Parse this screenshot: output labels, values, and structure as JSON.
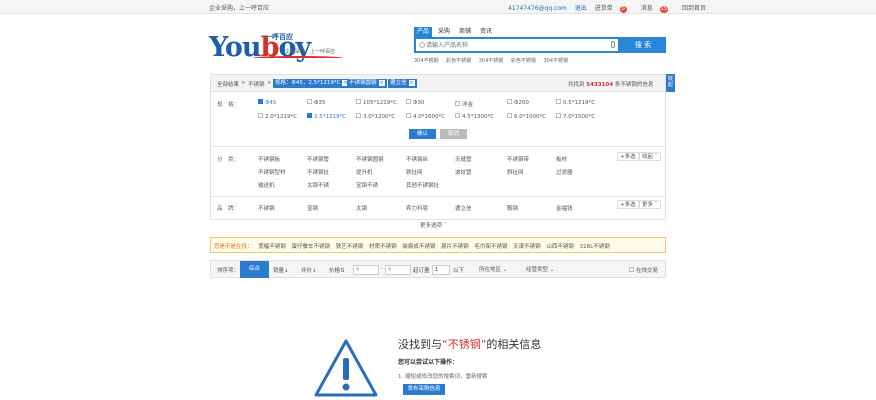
{
  "topbar": {
    "left": "企业采购，上一呼百应",
    "email": "41747476@qq.com",
    "exit": "退出",
    "purchase_label": "进货单",
    "purchase_count": "0",
    "messages_label": "消息",
    "messages_count": "15",
    "home": "回到首页"
  },
  "logo": {
    "word_a": "You",
    "word_b": "b",
    "word_c": "oy",
    "slogan_top": "一呼百应",
    "slogan": "企业采购，上一呼百应"
  },
  "search": {
    "tabs": [
      "产品",
      "采购",
      "商铺",
      "资讯"
    ],
    "placeholder": "请输入产品名称",
    "button": "搜 索",
    "hot": [
      "304不锈钢",
      "彩色不锈钢",
      "304不锈钢",
      "彩色不锈钢",
      "304不锈钢"
    ]
  },
  "crumb": {
    "all": "全部结果",
    "sep": ">",
    "keyword": "不锈钢",
    "tags": [
      "规格：Φ45，2.5*1219*C",
      "不锈钢圆钢",
      "德立信"
    ],
    "count_prefix": "共找到",
    "count": "5433104",
    "count_suffix": "条不锈钢的信息",
    "side_tab": "收起"
  },
  "filters": {
    "spec": {
      "label": "规　格：",
      "options": [
        [
          "Φ45",
          "Φ35",
          "105*1219*C",
          "Φ30",
          "洋金",
          "Φ200",
          "0.5*1219*C"
        ],
        [
          "2.0*1219*C",
          "2.5*1219*C",
          "3.0*1200*C",
          "4.0*1600*C",
          "4.5*1300*C",
          "6.0*1000*C",
          "7.0*1500*C"
        ]
      ],
      "ok": "确认",
      "cancel": "取消"
    },
    "category": {
      "label": "分　类：",
      "options": [
        [
          "不锈钢板",
          "不锈钢管",
          "不锈钢圆钢",
          "不锈钢丝",
          "无缝管",
          "不锈钢带",
          "板材"
        ],
        [
          "不锈钢型材",
          "不锈钢扯",
          "提升机",
          "铁扯网",
          "波纹管",
          "斜扯网",
          "过滤器"
        ],
        [
          "输送机",
          "太钢不锈",
          "宝钢不锈",
          "其他不锈钢扯"
        ]
      ],
      "multi": "+多选",
      "more": "收起"
    },
    "brand": {
      "label": "品　牌：",
      "options": [
        "不锈钢",
        "宝钢",
        "太钢",
        "宾力科恩",
        "德立信",
        "鞍钢",
        "金福钱"
      ],
      "multi": "+多选",
      "more": "更多"
    },
    "more_options": "更多选项"
  },
  "suggest": {
    "label": "您是不是在找：",
    "items": [
      "宽幅不锈钢",
      "蛋仔餐车不锈钢",
      "铁艺不锈钢",
      "材质不锈钢",
      "装扁成不锈钢",
      "扁片不锈钢",
      "毛巾架不锈钢",
      "天津不锈钢",
      "山西不锈钢",
      "316L不锈钢"
    ]
  },
  "sortbar": {
    "label": "排序项：",
    "default": "综合",
    "sales": "销量",
    "rating": "评价",
    "price": "价格",
    "price_from": "¥",
    "price_to": "¥",
    "moq_label": "起订量",
    "moq_value": "1",
    "moq_suffix": "以下",
    "location": "所在地区",
    "biz_type": "经营类型",
    "online": "在线交易"
  },
  "empty": {
    "title_a": "没找到与",
    "title_kw": "“不锈钢”",
    "title_b": "的相关信息",
    "tip": "您可以尝试以下操作：",
    "tip_1": "1. 缩短或修改您的搜索词，重新搜索",
    "post": "发布采购信息"
  }
}
